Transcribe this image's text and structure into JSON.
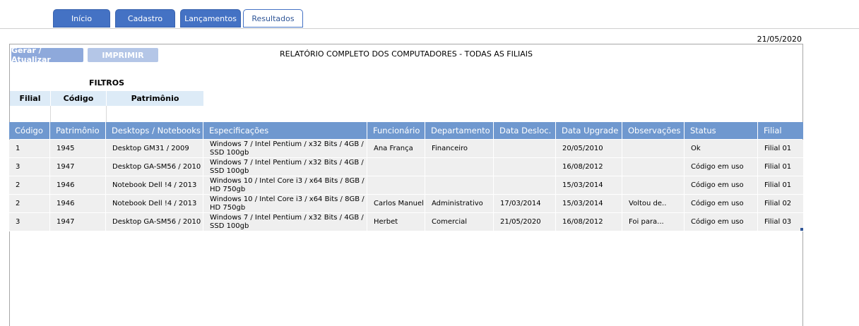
{
  "tabs": [
    {
      "label": "Início",
      "active": false
    },
    {
      "label": "Cadastro",
      "active": false
    },
    {
      "label": "Lançamentos",
      "active": false
    },
    {
      "label": "Resultados",
      "active": true
    }
  ],
  "date": "21/05/2020",
  "buttons": {
    "generate": "Gerar / Atualizar",
    "print": "IMPRIMIR"
  },
  "report_title": "RELATÓRIO COMPLETO DOS COMPUTADORES - TODAS AS FILIAIS",
  "filters": {
    "title": "FILTROS",
    "headers": [
      "Filial",
      "Código",
      "Patrimônio"
    ],
    "values": [
      "",
      "",
      ""
    ]
  },
  "table": {
    "headers": [
      "Código",
      "Patrimônio",
      "Desktops / Notebooks",
      "Especificações",
      "Funcionário",
      "Departamento",
      "Data Desloc.",
      "Data Upgrade",
      "Observações",
      "Status",
      "Filial"
    ],
    "rows": [
      [
        "1",
        "1945",
        "Desktop GM31 / 2009",
        "Windows 7 / Intel Pentium / x32 Bits / 4GB / SSD 100gb",
        "Ana França",
        "Financeiro",
        "",
        "20/05/2010",
        "",
        "Ok",
        "Filial 01"
      ],
      [
        "3",
        "1947",
        "Desktop GA-SM56 / 2010",
        "Windows 7 / Intel Pentium / x32 Bits / 4GB / SSD 100gb",
        "",
        "",
        "",
        "16/08/2012",
        "",
        "Código em uso",
        "Filial 01"
      ],
      [
        "2",
        "1946",
        "Notebook Dell !4 / 2013",
        "Windows 10 / Intel Core i3 / x64 Bits / 8GB / HD 750gb",
        "",
        "",
        "",
        "15/03/2014",
        "",
        "Código em uso",
        "Filial 01"
      ],
      [
        "2",
        "1946",
        "Notebook Dell !4 / 2013",
        "Windows 10 / Intel Core i3 / x64 Bits / 8GB / HD 750gb",
        "Carlos Manuel",
        "Administrativo",
        "17/03/2014",
        "15/03/2014",
        "Voltou de..",
        "Código em uso",
        "Filial 02"
      ],
      [
        "3",
        "1947",
        "Desktop GA-SM56 / 2010",
        "Windows 7 / Intel Pentium / x32 Bits / 4GB / SSD 100gb",
        "Herbet",
        "Comercial",
        "21/05/2020",
        "16/08/2012",
        "Foi para...",
        "Código em uso",
        "Filial 03"
      ]
    ]
  },
  "colors": {
    "tab_dark": "#4472c4",
    "header_blue": "#6f98cf",
    "filter_header": "#ddebf7",
    "row_gray": "#efefef",
    "button_blue": "#8ea9db"
  }
}
